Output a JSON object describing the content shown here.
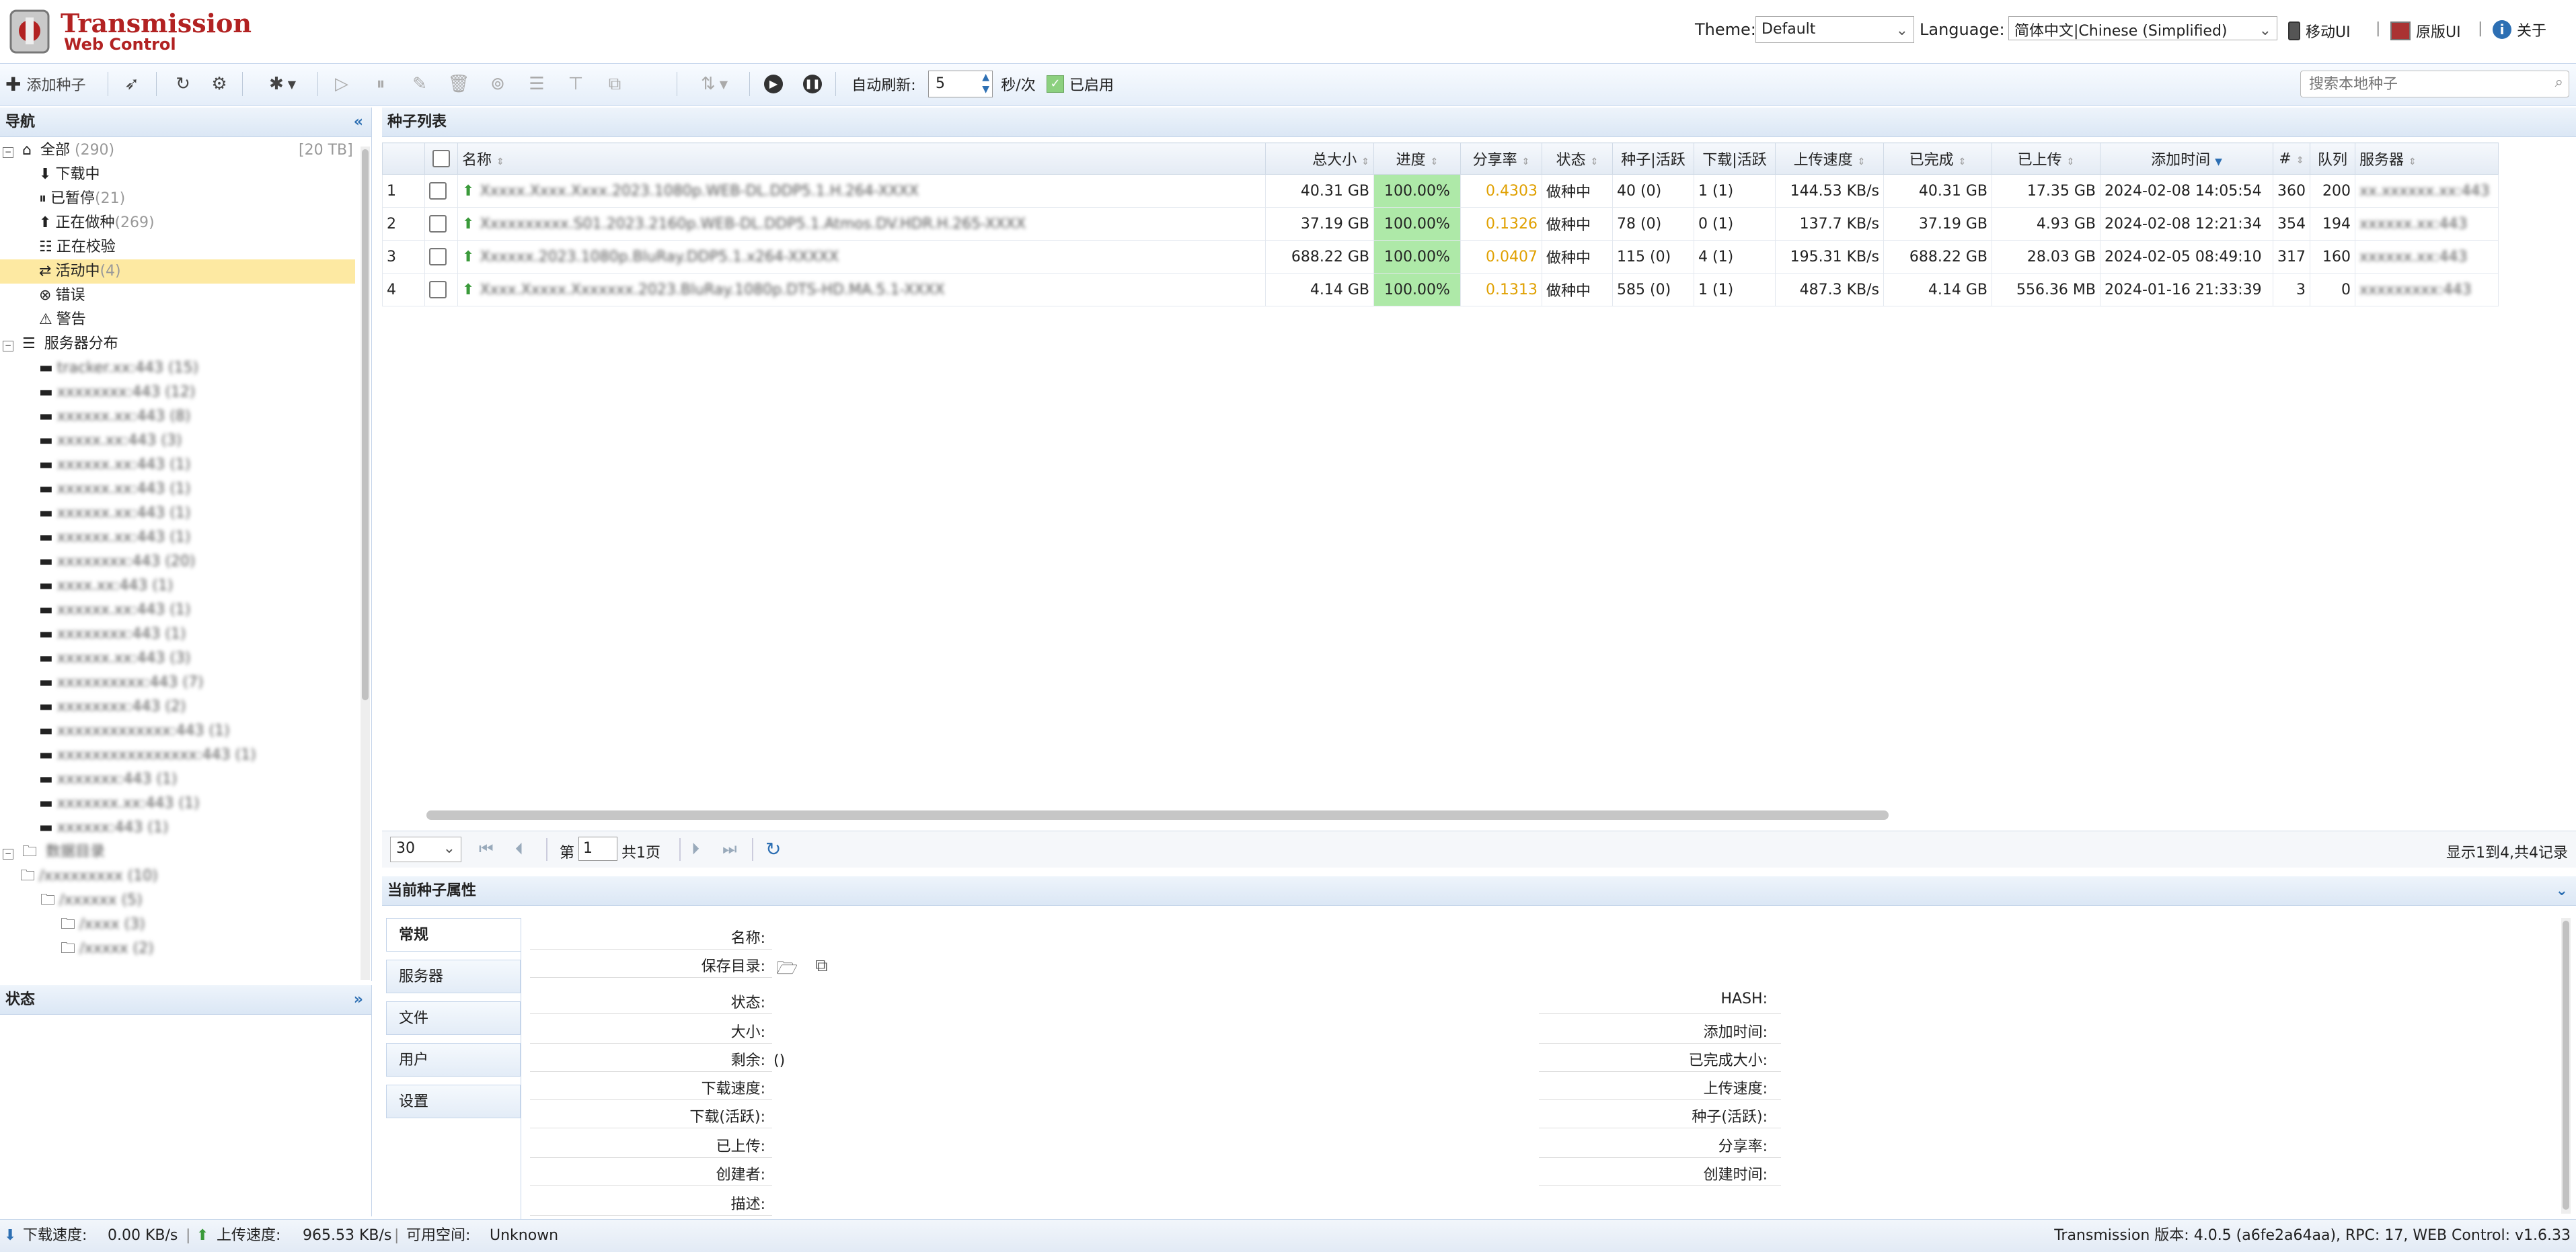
{
  "header": {
    "app_title": "Transmission",
    "app_subtitle": "Web Control",
    "theme_label": "Theme:",
    "theme_value": "Default",
    "language_label": "Language:",
    "language_value": "简体中文|Chinese (Simplified)",
    "mobile_ui": "移动UI",
    "original_ui": "原版UI",
    "about": "关于"
  },
  "toolbar": {
    "add_torrent": "添加种子",
    "auto_refresh_label": "自动刷新:",
    "refresh_seconds": "5",
    "refresh_unit": "秒/次",
    "enabled_label": "已启用",
    "search_placeholder": "搜索本地种子"
  },
  "nav": {
    "title": "导航",
    "items": [
      {
        "label": "全部",
        "count": "(290)",
        "size": "[20 TB]"
      },
      {
        "label": "下载中",
        "count": ""
      },
      {
        "label": "已暂停",
        "count": "(21)"
      },
      {
        "label": "正在做种",
        "count": "(269)"
      },
      {
        "label": "正在校验",
        "count": ""
      },
      {
        "label": "活动中",
        "count": "(4)"
      },
      {
        "label": "错误",
        "count": ""
      },
      {
        "label": "警告",
        "count": ""
      }
    ],
    "servers_label": "服务器分布",
    "folders_label": "数据目录",
    "servers_blurred": [
      "tracker.xx:443 (15)",
      "xxxxxxxx:443 (12)",
      "xxxxxx.xx:443 (8)",
      "xxxxx.xx:443 (3)",
      "xxxxxx.xx:443 (1)",
      "xxxxxx.xx:443 (1)",
      "xxxxxx.xx:443 (1)",
      "xxxxxx.xx:443 (1)",
      "xxxxxxxx:443 (20)",
      "xxxx.xx:443 (1)",
      "xxxxxx.xx:443 (1)",
      "xxxxxxxx:443 (1)",
      "xxxxxx.xx:443 (3)",
      "xxxxxxxxxx:443 (7)",
      "xxxxxxxx:443 (2)",
      "xxxxxxxxxxxxx:443 (1)",
      "xxxxxxxxxxxxxxxx:443 (1)",
      "xxxxxxx:443 (1)",
      "xxxxxxx.xx:443 (1)",
      "xxxxxx:443 (1)"
    ],
    "folders_blurred": [
      "/xxxxxxxxx (10)",
      "/xxxxxx (5)",
      "/xxxx (3)",
      "/xxxxx (2)"
    ]
  },
  "status_panel": {
    "title": "状态"
  },
  "torrents": {
    "title": "种子列表",
    "columns": [
      "名称",
      "总大小",
      "进度",
      "分享率",
      "状态",
      "种子|活跃",
      "下载|活跃",
      "上传速度",
      "已完成",
      "已上传",
      "添加时间",
      "#",
      "队列",
      "服务器"
    ],
    "rows": [
      {
        "idx": "1",
        "name": "Xxxxx.Xxxx.Xxxx.2023.1080p.WEB-DL.DDP5.1.H.264-XXXX",
        "size": "40.31 GB",
        "progress": "100.00%",
        "ratio": "0.4303",
        "status": "做种中",
        "seeds": "40 (0)",
        "peers": "1 (1)",
        "up": "144.53 KB/s",
        "done": "40.31 GB",
        "uploaded": "17.35 GB",
        "added": "2024-02-08 14:05:54",
        "num": "360",
        "queue": "200",
        "server": "xx.xxxxxx.xx:443"
      },
      {
        "idx": "2",
        "name": "Xxxxxxxxxx.S01.2023.2160p.WEB-DL.DDP5.1.Atmos.DV.HDR.H.265-XXXX",
        "size": "37.19 GB",
        "progress": "100.00%",
        "ratio": "0.1326",
        "status": "做种中",
        "seeds": "78 (0)",
        "peers": "0 (1)",
        "up": "137.7 KB/s",
        "done": "37.19 GB",
        "uploaded": "4.93 GB",
        "added": "2024-02-08 12:21:34",
        "num": "354",
        "queue": "194",
        "server": "xxxxxx.xx:443"
      },
      {
        "idx": "3",
        "name": "Xxxxxx.2023.1080p.BluRay.DDP5.1.x264-XXXXX",
        "size": "688.22 GB",
        "progress": "100.00%",
        "ratio": "0.0407",
        "status": "做种中",
        "seeds": "115 (0)",
        "peers": "4 (1)",
        "up": "195.31 KB/s",
        "done": "688.22 GB",
        "uploaded": "28.03 GB",
        "added": "2024-02-05 08:49:10",
        "num": "317",
        "queue": "160",
        "server": "xxxxxx.xx:443"
      },
      {
        "idx": "4",
        "name": "Xxxx.Xxxxx.Xxxxxxx.2023.BluRay.1080p.DTS-HD.MA.5.1-XXXX",
        "size": "4.14 GB",
        "progress": "100.00%",
        "ratio": "0.1313",
        "status": "做种中",
        "seeds": "585 (0)",
        "peers": "1 (1)",
        "up": "487.3 KB/s",
        "done": "4.14 GB",
        "uploaded": "556.36 MB",
        "added": "2024-01-16 21:33:39",
        "num": "3",
        "queue": "0",
        "server": "xxxxxxxxx:443"
      }
    ]
  },
  "pager": {
    "page_size": "30",
    "page_prefix": "第",
    "page_value": "1",
    "page_suffix": "共1页",
    "summary": "显示1到4,共4记录"
  },
  "props": {
    "title": "当前种子属性",
    "tabs": [
      "常规",
      "服务器",
      "文件",
      "用户",
      "设置"
    ],
    "left_labels": [
      "名称:",
      "保存目录:",
      "状态:",
      "大小:",
      "剩余:",
      "下载速度:",
      "下载(活跃):",
      "已上传:",
      "创建者:",
      "描述:"
    ],
    "right_labels": [
      "HASH:",
      "添加时间:",
      "已完成大小:",
      "上传速度:",
      "种子(活跃):",
      "分享率:",
      "创建时间:"
    ],
    "remaining_value": "()"
  },
  "statusbar": {
    "download_label": "下载速度:",
    "download_value": "0.00 KB/s",
    "upload_label": "上传速度:",
    "upload_value": "965.53 KB/s",
    "space_label": "可用空间:",
    "space_value": "Unknown",
    "version": "Transmission 版本: 4.0.5 (a6fe2a64aa), RPC: 17, WEB Control: v1.6.33"
  },
  "colors": {
    "accent": "#2d6fb3",
    "progress": "#aee9a8",
    "ratio": "#e0a000",
    "brand": "#b22222"
  }
}
